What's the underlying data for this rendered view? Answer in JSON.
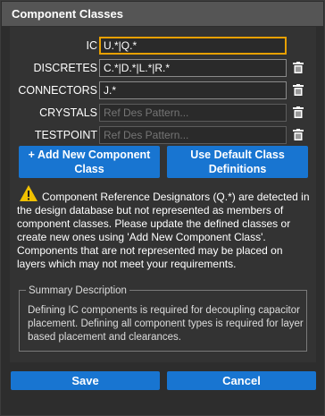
{
  "dialog": {
    "title": "Component Classes"
  },
  "classes": [
    {
      "label": "IC",
      "value": "U.*|Q.*",
      "placeholder": "Ref Des Pattern...",
      "removable": false
    },
    {
      "label": "DISCRETES",
      "value": "C.*|D.*|L.*|R.*",
      "placeholder": "Ref Des Pattern...",
      "removable": true
    },
    {
      "label": "CONNECTORS",
      "value": "J.*",
      "placeholder": "Ref Des Pattern...",
      "removable": true
    },
    {
      "label": "CRYSTALS",
      "value": "",
      "placeholder": "Ref Des Pattern...",
      "removable": true
    },
    {
      "label": "TESTPOINT",
      "value": "",
      "placeholder": "Ref Des Pattern...",
      "removable": true
    }
  ],
  "actions": {
    "add_class_label": "+ Add New Component Class",
    "default_class_label": "Use Default Class Definitions"
  },
  "warning": {
    "icon": "warning-icon",
    "text": "Component Reference Designators (Q.*) are detected in the design database but not represented as members of component classes. Please update the defined classes or create new ones using 'Add New Component Class'. Components that are not represented may be placed on layers which may not meet your requirements."
  },
  "summary": {
    "legend": "Summary Description",
    "text": "Defining IC components is required for decoupling capacitor placement. Defining all component types is required for layer based placement and clearances."
  },
  "footer": {
    "save_label": "Save",
    "cancel_label": "Cancel"
  },
  "colors": {
    "accent": "#1875d1",
    "focus": "#e8a000",
    "warning": "#f0c000",
    "background": "#333333"
  }
}
